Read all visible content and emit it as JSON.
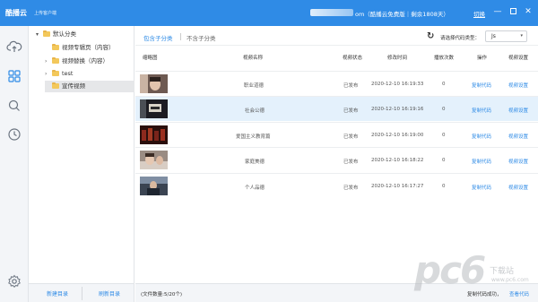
{
  "app": {
    "logo": "酷播云",
    "subtitle": "上传客户端",
    "account": "om（酷播云免费版｜剩余1808天）",
    "switch_label": "切换"
  },
  "window_controls": {
    "minimize": "—",
    "close": "✕"
  },
  "rail": [
    "upload-cloud-icon",
    "apps-grid-icon",
    "search-icon",
    "clock-icon",
    "settings-gear-icon"
  ],
  "tree": {
    "items": [
      {
        "label": "默认分类",
        "arrow": "▾"
      },
      {
        "label": "视频专辑页（内容）",
        "arrow": ""
      },
      {
        "label": "视频替换（内容）",
        "arrow": "›"
      },
      {
        "label": "test",
        "arrow": "›"
      },
      {
        "label": "宣传视频",
        "arrow": ""
      }
    ],
    "footer": {
      "new_folder": "新建目录",
      "refresh_folder": "刷新目录"
    }
  },
  "toolbar": {
    "tab_include": "包含子分类",
    "tab_exclude": "不含子分类",
    "refresh_icon": "↻",
    "code_type_label": "请选择代码类型：",
    "code_type_value": "Js",
    "code_type_chevron": "▾"
  },
  "table": {
    "headers": [
      "缩略图",
      "视频名称",
      "视频状态",
      "修改时间",
      "播放次数",
      "操作",
      "视频设置"
    ],
    "rows": [
      {
        "name": "职业道德",
        "status": "已发布",
        "time": "2020-12-10 16:19:33",
        "plays": "0",
        "op": "复制代码",
        "settings": "视频设置"
      },
      {
        "name": "社会公德",
        "status": "已发布",
        "time": "2020-12-10 16:19:16",
        "plays": "0",
        "op": "复制代码",
        "settings": "视频设置"
      },
      {
        "name": "爱国主义教育篇",
        "status": "已发布",
        "time": "2020-12-10 16:19:00",
        "plays": "0",
        "op": "复制代码",
        "settings": "视频设置"
      },
      {
        "name": "家庭美德",
        "status": "已发布",
        "time": "2020-12-10 16:18:22",
        "plays": "0",
        "op": "复制代码",
        "settings": "视频设置"
      },
      {
        "name": "个人品德",
        "status": "已发布",
        "time": "2020-12-10 16:17:27",
        "plays": "0",
        "op": "复制代码",
        "settings": "视频设置"
      }
    ]
  },
  "status": {
    "file_count": "(文件数量:5/20个)",
    "copy_success": "复制代码成功，",
    "view_code": "查看代码"
  },
  "watermark": {
    "main": "pc6",
    "sub": "下载站",
    "url": "www.pc6.com"
  },
  "colors": {
    "accent": "#2f8be6",
    "folder": "#f3c85b",
    "selected_row": "#e4f1fc"
  }
}
